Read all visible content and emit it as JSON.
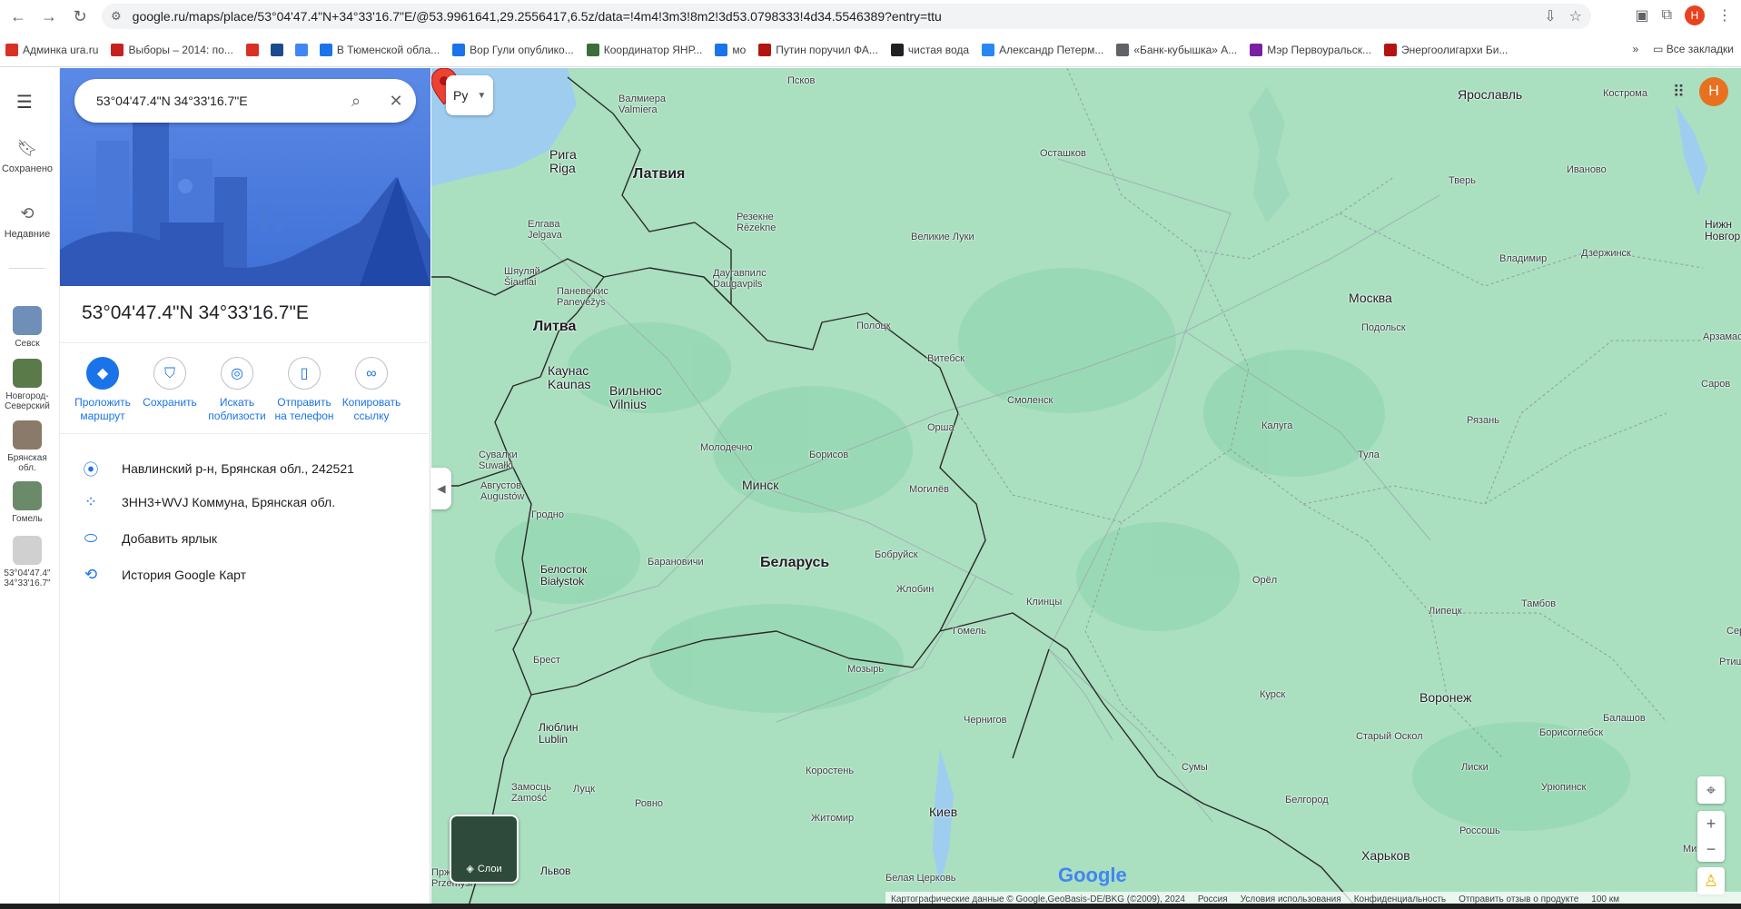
{
  "browser": {
    "url": "google.ru/maps/place/53°04'47.4\"N+34°33'16.7\"E/@53.9961641,29.2556417,6.5z/data=!4m4!3m3!8m2!3d53.0798333!4d34.5546389?entry=ttu",
    "profile_initial": "H",
    "bookmarks": [
      {
        "label": "Админка ura.ru",
        "color": "#d93025"
      },
      {
        "label": "Выборы – 2014: по...",
        "color": "#c5221f"
      },
      {
        "label": "",
        "color": "#d93025"
      },
      {
        "label": "",
        "color": "#1a4b8c"
      },
      {
        "label": "",
        "color": "#4285f4"
      },
      {
        "label": "В Тюменской обла...",
        "color": "#1a73e8"
      },
      {
        "label": "Вор Гули опублико...",
        "color": "#1a73e8"
      },
      {
        "label": "Координатор ЯНР...",
        "color": "#3c6e3c"
      },
      {
        "label": "мо",
        "color": "#1a73e8"
      },
      {
        "label": "Путин поручил ФА...",
        "color": "#b31412"
      },
      {
        "label": "чистая вода",
        "color": "#202124"
      },
      {
        "label": "Александр Петерм...",
        "color": "#2787f5"
      },
      {
        "label": "«Банк-кубышка» А...",
        "color": "#5f6368"
      },
      {
        "label": "Мэр Первоуральск...",
        "color": "#7b1fa2"
      },
      {
        "label": "Энергоолигархи Би...",
        "color": "#b31412"
      }
    ],
    "all_bookmarks": "Все закладки"
  },
  "rail": {
    "saved": "Сохранено",
    "recent": "Недавние",
    "recents": [
      {
        "label": "Севск",
        "color": "#6f8fb8"
      },
      {
        "label": "Новгород-\nСеверский",
        "color": "#5a7a4a"
      },
      {
        "label": "Брянская\nобл.",
        "color": "#8a7a6a"
      },
      {
        "label": "Гомель",
        "color": "#6a8a6a"
      },
      {
        "label": "53°04'47.4\"\n34°33'16.7\"",
        "color": "#d0d0d0"
      }
    ]
  },
  "panel": {
    "search_value": "53°04'47.4\"N 34°33'16.7\"E",
    "title": "53°04'47.4\"N 34°33'16.7\"E",
    "actions": [
      {
        "label": "Проложить маршрут",
        "icon": "directions-icon"
      },
      {
        "label": "Сохранить",
        "icon": "bookmark-icon"
      },
      {
        "label": "Искать поблизости",
        "icon": "nearby-icon"
      },
      {
        "label": "Отправить на телефон",
        "icon": "send-to-phone-icon"
      },
      {
        "label": "Копировать ссылку",
        "icon": "link-icon"
      }
    ],
    "address": "Навлинский р-н, Брянская обл., 242521",
    "plus_code": "3HH3+WVJ Коммуна, Брянская обл.",
    "add_label": "Добавить ярлык",
    "history": "История Google Карт"
  },
  "map": {
    "lang_button": "Ру",
    "layers_label": "Слои",
    "avatar_initial": "H",
    "logo": "Google",
    "footer": [
      "Картографические данные © Google,GeoBasis-DE/BKG (©2009), 2024",
      "Россия",
      "Условия использования",
      "Конфиденциальность",
      "Отправить отзыв о продукте",
      "100 км"
    ],
    "labels": [
      {
        "t": "Латвия",
        "c": "country"
      },
      {
        "t": "Литва",
        "c": "country"
      },
      {
        "t": "Беларусь",
        "c": "country"
      },
      {
        "t": "Москва",
        "c": "big"
      },
      {
        "t": "Воронеж",
        "c": "big"
      },
      {
        "t": "Ярославль",
        "c": "big"
      },
      {
        "t": "Минск",
        "c": "big"
      },
      {
        "t": "Харьков",
        "c": "big"
      },
      {
        "t": "Киев",
        "c": "big"
      },
      {
        "t": "Рига\nRiga",
        "c": "big"
      },
      {
        "t": "Вильнюс\nVilnius",
        "c": "big"
      },
      {
        "t": "Каунас\nKaunas",
        "c": "big"
      },
      {
        "t": "Белосток\nBiałystok",
        "c": "med"
      },
      {
        "t": "Люблин\nLublin",
        "c": "med"
      },
      {
        "t": "Львов",
        "c": "med"
      },
      {
        "t": "Псков",
        "c": ""
      },
      {
        "t": "Кострома",
        "c": ""
      },
      {
        "t": "Тверь",
        "c": ""
      },
      {
        "t": "Иваново",
        "c": ""
      },
      {
        "t": "Осташков",
        "c": ""
      },
      {
        "t": "Великие Луки",
        "c": ""
      },
      {
        "t": "Владимир",
        "c": ""
      },
      {
        "t": "Дзержинск",
        "c": ""
      },
      {
        "t": "Нижн\nНовгор",
        "c": "med"
      },
      {
        "t": "Подольск",
        "c": ""
      },
      {
        "t": "Арзамас",
        "c": ""
      },
      {
        "t": "Саров",
        "c": ""
      },
      {
        "t": "Рязань",
        "c": ""
      },
      {
        "t": "Калуга",
        "c": ""
      },
      {
        "t": "Тула",
        "c": ""
      },
      {
        "t": "Смоленск",
        "c": ""
      },
      {
        "t": "Витебск",
        "c": ""
      },
      {
        "t": "Полоцк",
        "c": ""
      },
      {
        "t": "Орша",
        "c": ""
      },
      {
        "t": "Борисов",
        "c": ""
      },
      {
        "t": "Могилёв",
        "c": ""
      },
      {
        "t": "Молодечно",
        "c": ""
      },
      {
        "t": "Бобруйск",
        "c": ""
      },
      {
        "t": "Жлобин",
        "c": ""
      },
      {
        "t": "Барановичи",
        "c": ""
      },
      {
        "t": "Гомель",
        "c": ""
      },
      {
        "t": "Мозырь",
        "c": ""
      },
      {
        "t": "Брест",
        "c": ""
      },
      {
        "t": "Гродно",
        "c": ""
      },
      {
        "t": "Клинцы",
        "c": ""
      },
      {
        "t": "Орёл",
        "c": ""
      },
      {
        "t": "Липецк",
        "c": ""
      },
      {
        "t": "Тамбов",
        "c": ""
      },
      {
        "t": "Курск",
        "c": ""
      },
      {
        "t": "Старый Оскол",
        "c": ""
      },
      {
        "t": "Сумы",
        "c": ""
      },
      {
        "t": "Белгород",
        "c": ""
      },
      {
        "t": "Борисоглебск",
        "c": ""
      },
      {
        "t": "Балашов",
        "c": ""
      },
      {
        "t": "Лиски",
        "c": ""
      },
      {
        "t": "Урюпинск",
        "c": ""
      },
      {
        "t": "Россошь",
        "c": ""
      },
      {
        "t": "Михайло",
        "c": ""
      },
      {
        "t": "Ртищево",
        "c": ""
      },
      {
        "t": "Серд",
        "c": ""
      },
      {
        "t": "Чернигов",
        "c": ""
      },
      {
        "t": "Коростень",
        "c": ""
      },
      {
        "t": "Житомир",
        "c": ""
      },
      {
        "t": "Ровно",
        "c": ""
      },
      {
        "t": "Луцк",
        "c": ""
      },
      {
        "t": "Замосць\nZamość",
        "c": ""
      },
      {
        "t": "Белая Церковь",
        "c": ""
      },
      {
        "t": "Елгава\nJelgava",
        "c": ""
      },
      {
        "t": "Валмиера\nValmiera",
        "c": ""
      },
      {
        "t": "Резекне\nRēzekne",
        "c": ""
      },
      {
        "t": "Даугавпилс\nDaugavpils",
        "c": ""
      },
      {
        "t": "Шяуляй\nŠiauliai",
        "c": ""
      },
      {
        "t": "Паневежис\nPanevėžys",
        "c": ""
      },
      {
        "t": "Сувалки\nSuwałki",
        "c": ""
      },
      {
        "t": "Августов\nAugustów",
        "c": ""
      },
      {
        "t": "Пржемысль\nPrzemyśl",
        "c": ""
      }
    ]
  }
}
